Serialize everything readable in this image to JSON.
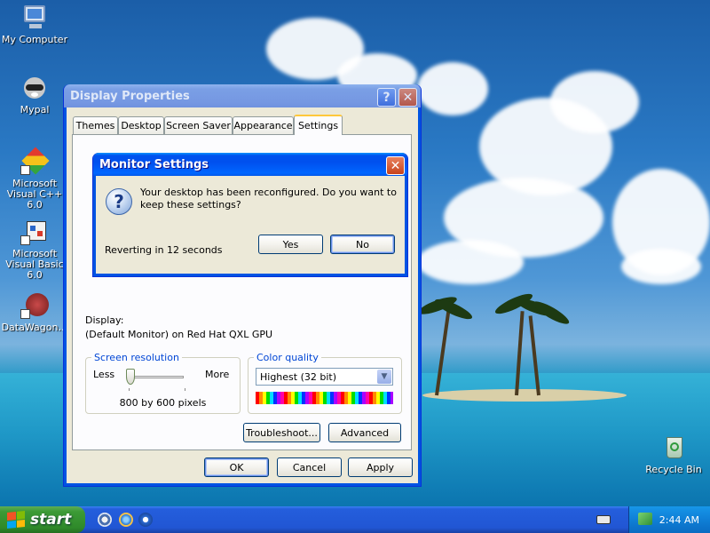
{
  "desktop": {
    "icons": [
      {
        "label": "My Computer",
        "glyph": "computer-icon"
      },
      {
        "label": "Mypal",
        "glyph": "raccoon-icon"
      },
      {
        "label": "Microsoft Visual C++ 6.0",
        "glyph": "visual-cpp-icon"
      },
      {
        "label": "Microsoft Visual Basic 6.0",
        "glyph": "visual-basic-icon"
      },
      {
        "label": "DataWagon…",
        "glyph": "datawagon-icon"
      },
      {
        "label": "Recycle Bin",
        "glyph": "recycle-bin-icon"
      }
    ]
  },
  "display_properties": {
    "title": "Display Properties",
    "tabs": [
      "Themes",
      "Desktop",
      "Screen Saver",
      "Appearance",
      "Settings"
    ],
    "active_tab": "Settings",
    "display_label": "Display:",
    "display_value": "(Default Monitor) on Red Hat QXL GPU",
    "resolution": {
      "legend": "Screen resolution",
      "less": "Less",
      "more": "More",
      "value": "800 by 600 pixels",
      "slider_position": 0
    },
    "color_quality": {
      "legend": "Color quality",
      "selected": "Highest (32 bit)"
    },
    "buttons": {
      "troubleshoot": "Troubleshoot...",
      "advanced": "Advanced",
      "ok": "OK",
      "cancel": "Cancel",
      "apply": "Apply"
    }
  },
  "monitor_settings": {
    "title": "Monitor Settings",
    "message": "Your desktop has been reconfigured.  Do you want to keep these settings?",
    "countdown": "Reverting in 12 seconds",
    "yes_label": "Yes",
    "no_label": "No"
  },
  "taskbar": {
    "start_label": "start",
    "clock": "2:44 AM"
  },
  "colors": {
    "xp_blue": "#0054e3",
    "start_green": "#3c9a36",
    "tab_highlight": "#ffc83c"
  }
}
